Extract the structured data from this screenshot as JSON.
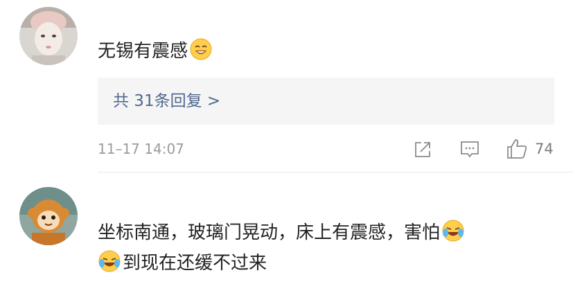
{
  "comments": [
    {
      "avatar": "avatar-girl-face-mask",
      "text": "无锡有震感",
      "trailing_emoji": "grin-emoji",
      "replies_label": "共 31条回复 >",
      "timestamp": "11–17 14:07",
      "actions": {
        "share_icon": "share-icon",
        "comment_icon": "comment-icon",
        "like_icon": "thumbs-up-icon",
        "like_count": "74"
      }
    },
    {
      "avatar": "avatar-monkey-plush",
      "text_line1": "坐标南通，玻璃门晃动，床上有震感，害怕",
      "line1_emoji": "laugh-cry-emoji",
      "line2_emoji": "laugh-cry-emoji",
      "text_line2": "到现在还缓不过来"
    }
  ],
  "colors": {
    "text": "#222222",
    "link": "#51688f",
    "meta": "#9b9b9b",
    "reply_bg": "#f5f5f5",
    "divider": "#e9e9e9"
  }
}
